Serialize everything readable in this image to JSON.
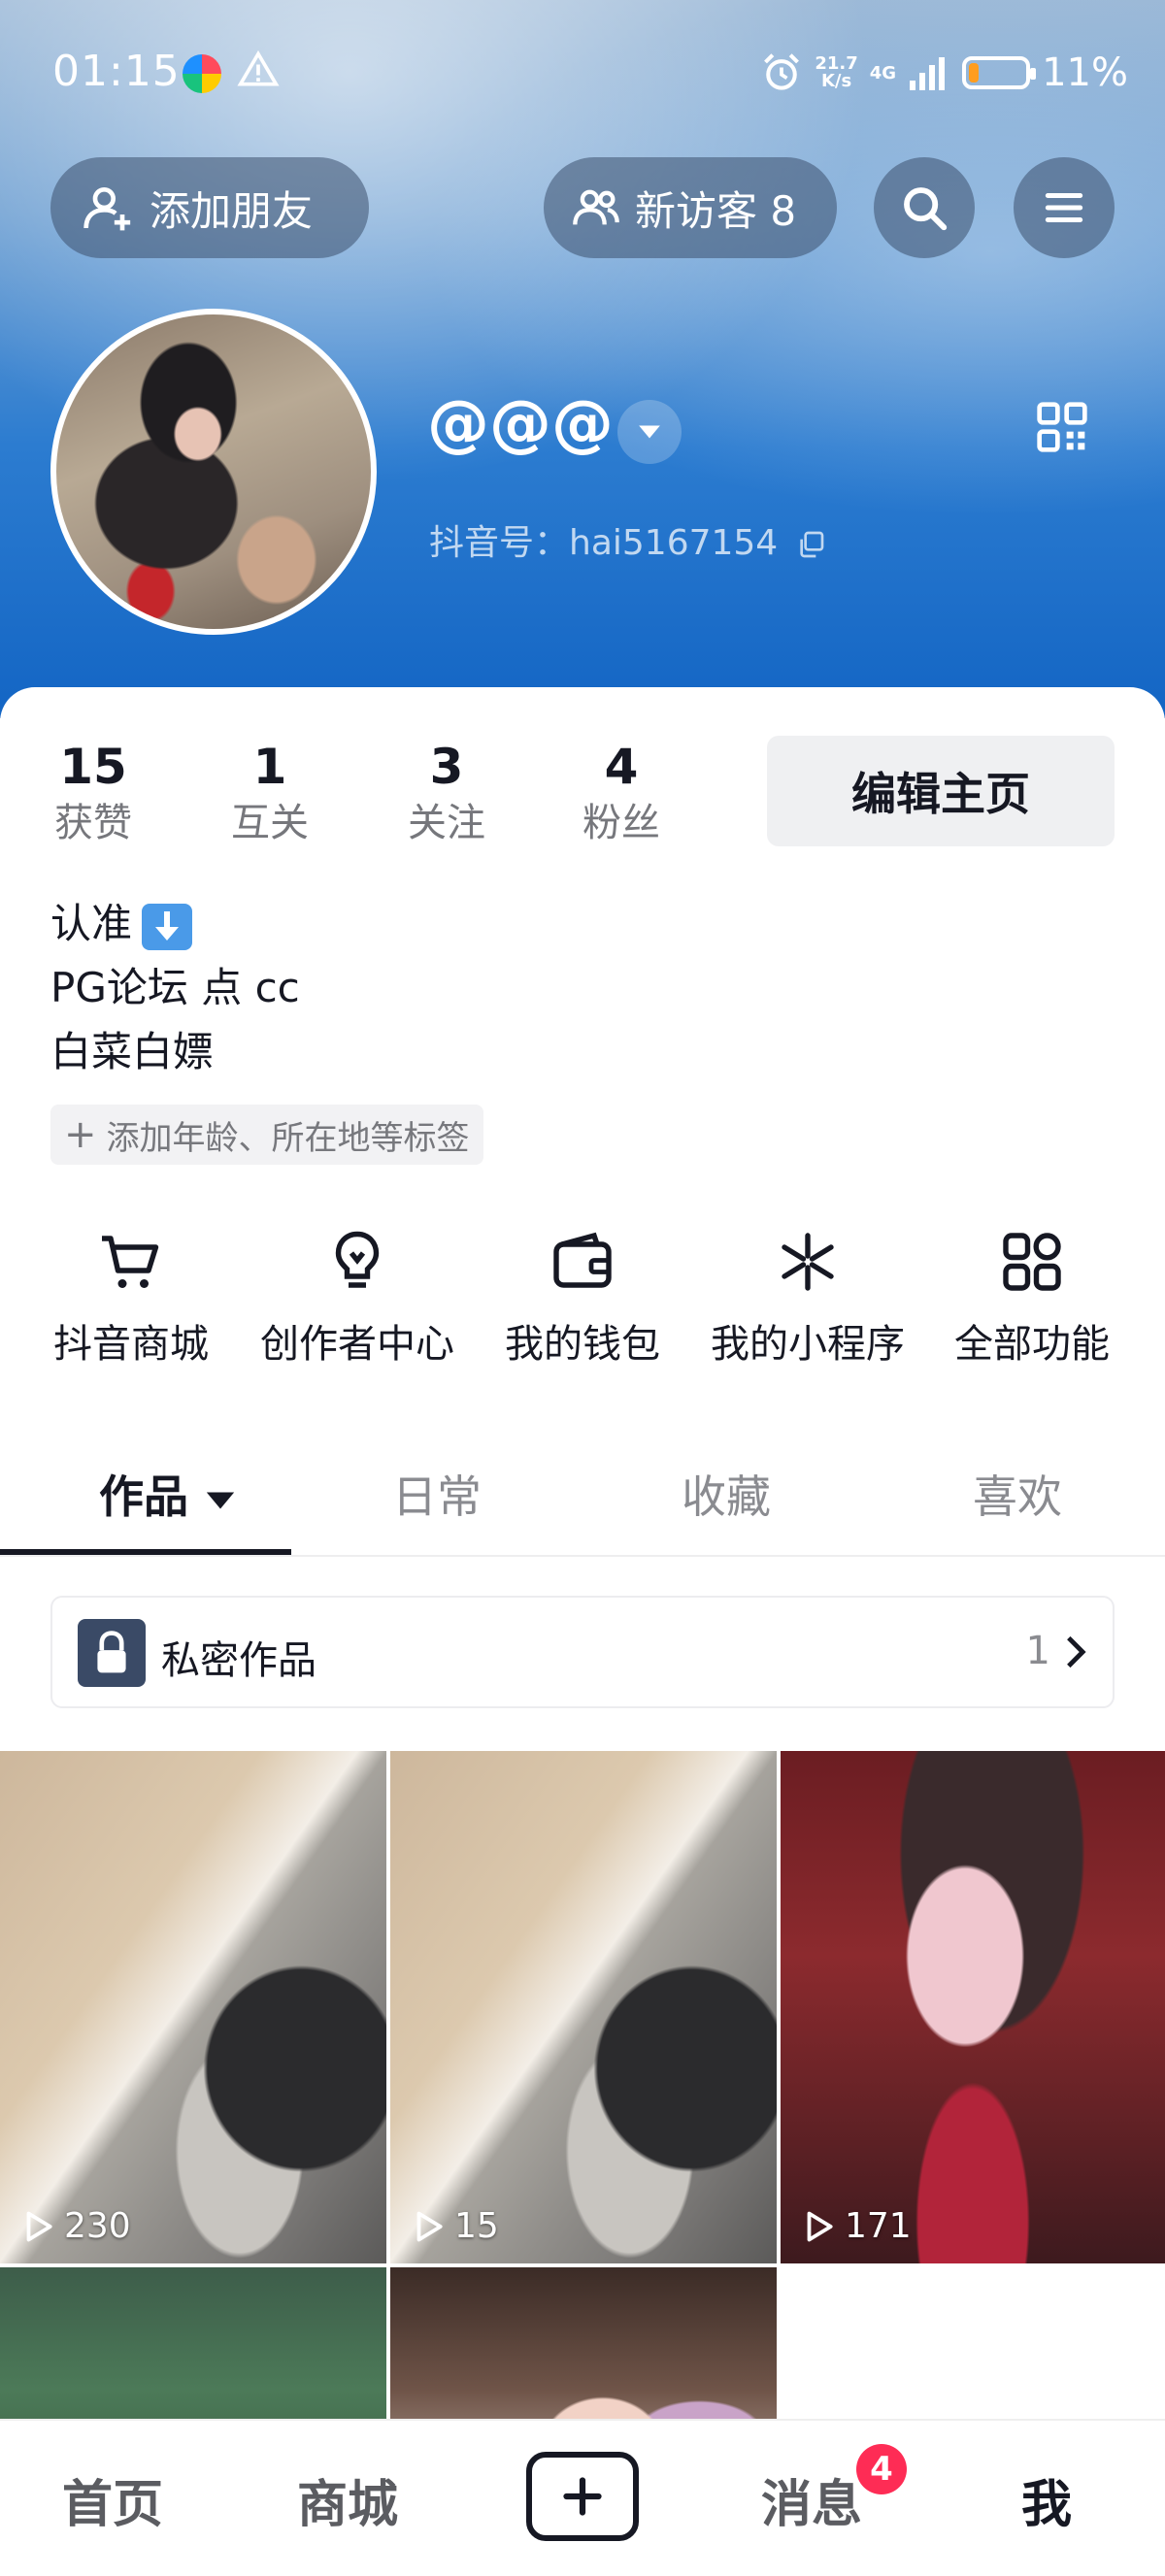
{
  "status_bar": {
    "time": "01:15",
    "net_speed_value": "21.7",
    "net_speed_unit": "K/s",
    "network": "4G",
    "battery_percent": "11%",
    "battery_level": 0.11,
    "battery_color": "#ff9d1f"
  },
  "top_bar": {
    "add_friend_label": "添加朋友",
    "visitors_label": "新访客 8",
    "search_icon": "search-icon",
    "menu_icon": "menu-icon"
  },
  "profile": {
    "nickname": "@@@",
    "douyin_id": "抖音号：hai5167154"
  },
  "stats": [
    {
      "value": "15",
      "label": "获赞"
    },
    {
      "value": "1",
      "label": "互关"
    },
    {
      "value": "3",
      "label": "关注"
    },
    {
      "value": "4",
      "label": "粉丝"
    }
  ],
  "edit_button_label": "编辑主页",
  "bio": {
    "line1": "认准",
    "line2": "PG论坛 点 cc",
    "line3": "白菜白嫖"
  },
  "tag_add_label": "添加年龄、所在地等标签",
  "functions": [
    {
      "label": "抖音商城",
      "icon": "cart-icon"
    },
    {
      "label": "创作者中心",
      "icon": "lightbulb-icon"
    },
    {
      "label": "我的钱包",
      "icon": "wallet-icon"
    },
    {
      "label": "我的小程序",
      "icon": "mini-program-icon"
    },
    {
      "label": "全部功能",
      "icon": "grid-icon"
    }
  ],
  "tabs": [
    {
      "label": "作品",
      "active": true
    },
    {
      "label": "日常",
      "active": false
    },
    {
      "label": "收藏",
      "active": false
    },
    {
      "label": "喜欢",
      "active": false
    }
  ],
  "private_works": {
    "label": "私密作品",
    "count": "1"
  },
  "videos": [
    {
      "plays": "230"
    },
    {
      "plays": "15"
    },
    {
      "plays": "171"
    }
  ],
  "bottom_nav": {
    "home": "首页",
    "mall": "商城",
    "messages": "消息",
    "messages_badge": "4",
    "me": "我"
  },
  "colors": {
    "accent": "#fe2c55",
    "header_blue": "#1365c4"
  }
}
